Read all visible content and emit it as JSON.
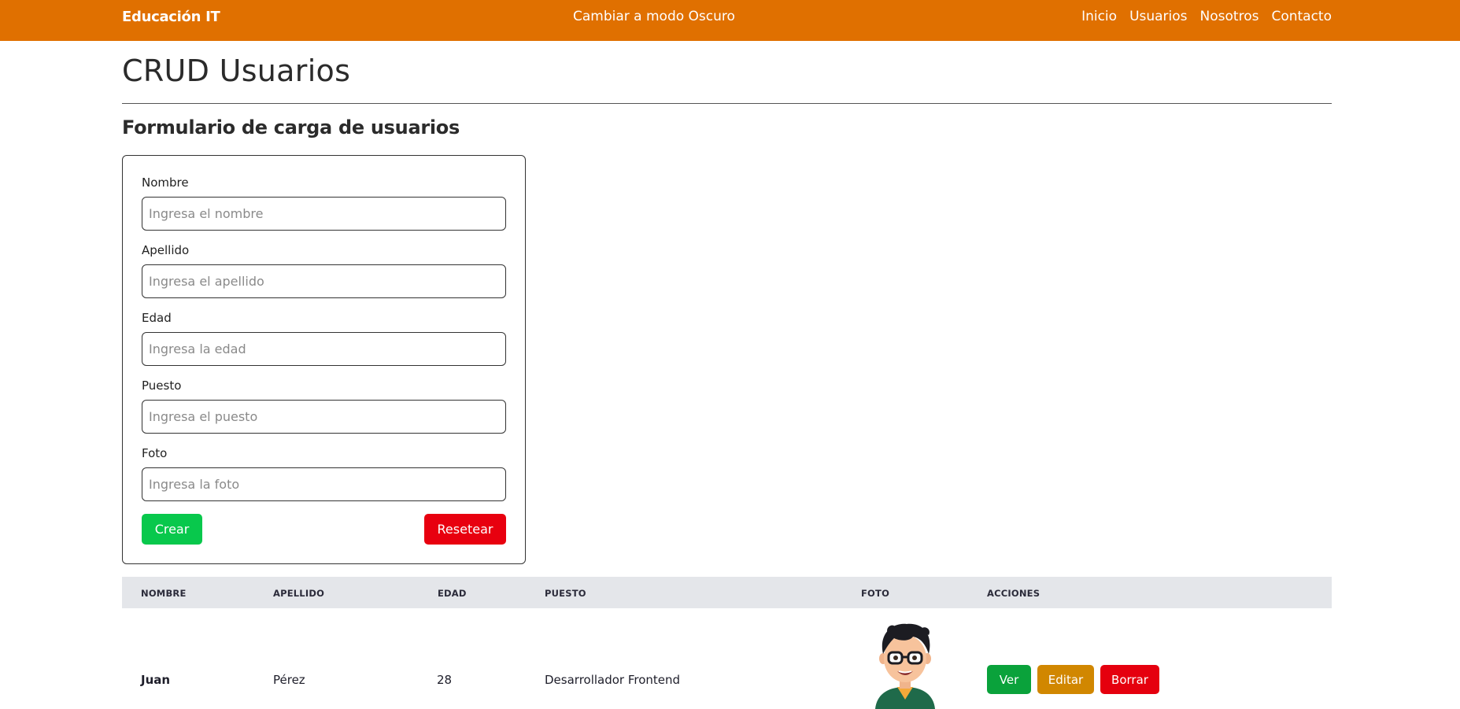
{
  "navbar": {
    "brand": "Educación IT",
    "theme_toggle": "Cambiar a modo Oscuro",
    "links": [
      "Inicio",
      "Usuarios",
      "Nosotros",
      "Contacto"
    ]
  },
  "page": {
    "title": "CRUD Usuarios",
    "form_title": "Formulario de carga de usuarios"
  },
  "form": {
    "fields": [
      {
        "label": "Nombre",
        "placeholder": "Ingresa el nombre",
        "value": ""
      },
      {
        "label": "Apellido",
        "placeholder": "Ingresa el apellido",
        "value": ""
      },
      {
        "label": "Edad",
        "placeholder": "Ingresa la edad",
        "value": ""
      },
      {
        "label": "Puesto",
        "placeholder": "Ingresa el puesto",
        "value": ""
      },
      {
        "label": "Foto",
        "placeholder": "Ingresa la foto",
        "value": ""
      }
    ],
    "create_label": "Crear",
    "reset_label": "Resetear"
  },
  "table": {
    "headers": [
      "NOMBRE",
      "APELLIDO",
      "EDAD",
      "PUESTO",
      "FOTO",
      "ACCIONES"
    ],
    "rows": [
      {
        "nombre": "Juan",
        "apellido": "Pérez",
        "edad": "28",
        "puesto": "Desarrollador Frontend",
        "foto_icon": "cartoon-avatar-glasses",
        "actions": [
          "Ver",
          "Editar",
          "Borrar"
        ]
      }
    ]
  },
  "colors": {
    "navbar": "#e07000",
    "create": "#08c84c",
    "reset": "#e8000f",
    "ver": "#0aa23b",
    "editar": "#d18700",
    "borrar": "#e5000e",
    "table_header": "#e4e6ea"
  }
}
